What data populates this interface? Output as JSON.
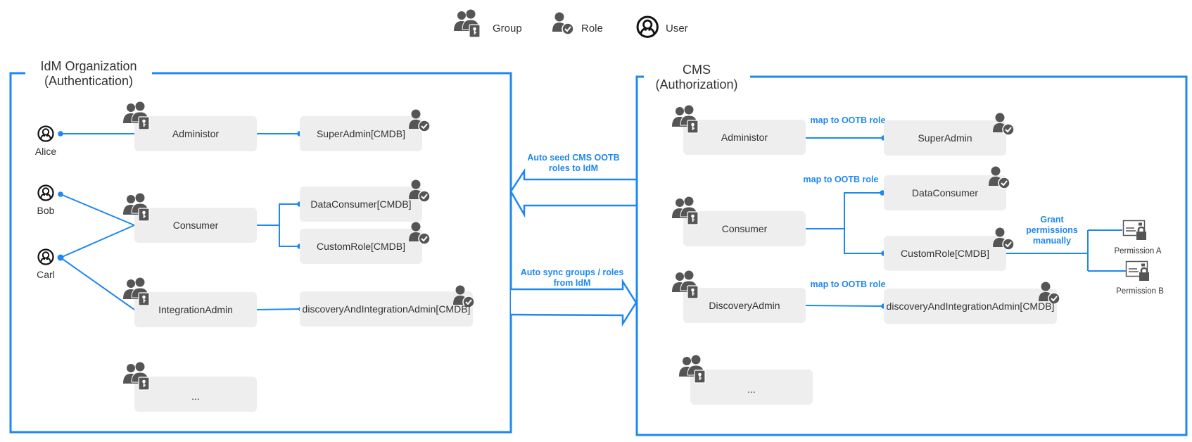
{
  "legend": [
    {
      "icon": "group-icon",
      "label": "Group"
    },
    {
      "icon": "role-icon",
      "label": "Role"
    },
    {
      "icon": "user-icon",
      "label": "User"
    }
  ],
  "colors": {
    "accent": "#1e88f0",
    "node_fill": "#eeeeee",
    "icon_fill": "#555555",
    "text": "#333333"
  },
  "idm": {
    "title_line1": "IdM Organization",
    "title_line2": "(Authentication)",
    "users": [
      "Alice",
      "Bob",
      "Carl"
    ],
    "groups": [
      "Administor",
      "Consumer",
      "IntegrationAdmin",
      "..."
    ],
    "roles": [
      "SuperAdmin[CMDB]",
      "DataConsumer[CMDB]",
      "CustomRole[CMDB]",
      "discoveryAndIntegrationAdmin[CMDB]"
    ]
  },
  "cms": {
    "title_line1": "CMS",
    "title_line2": "(Authorization)",
    "groups": [
      "Administor",
      "Consumer",
      "DiscoveryAdmin",
      "..."
    ],
    "roles": [
      "SuperAdmin",
      "DataConsumer",
      "CustomRole[CMDB]",
      "discoveryAndIntegrationAdmin[CMDB]"
    ],
    "map_labels": [
      "map to OOTB role",
      "map to OOTB role",
      "map to OOTB role"
    ],
    "grant_label": [
      "Grant",
      "permissions",
      "manually"
    ],
    "permissions": [
      "Permission A",
      "Permission B"
    ]
  },
  "arrows": {
    "seed_label": [
      "Auto seed CMS OOTB",
      "roles to IdM"
    ],
    "sync_label": [
      "Auto sync groups / roles",
      "from IdM"
    ]
  }
}
